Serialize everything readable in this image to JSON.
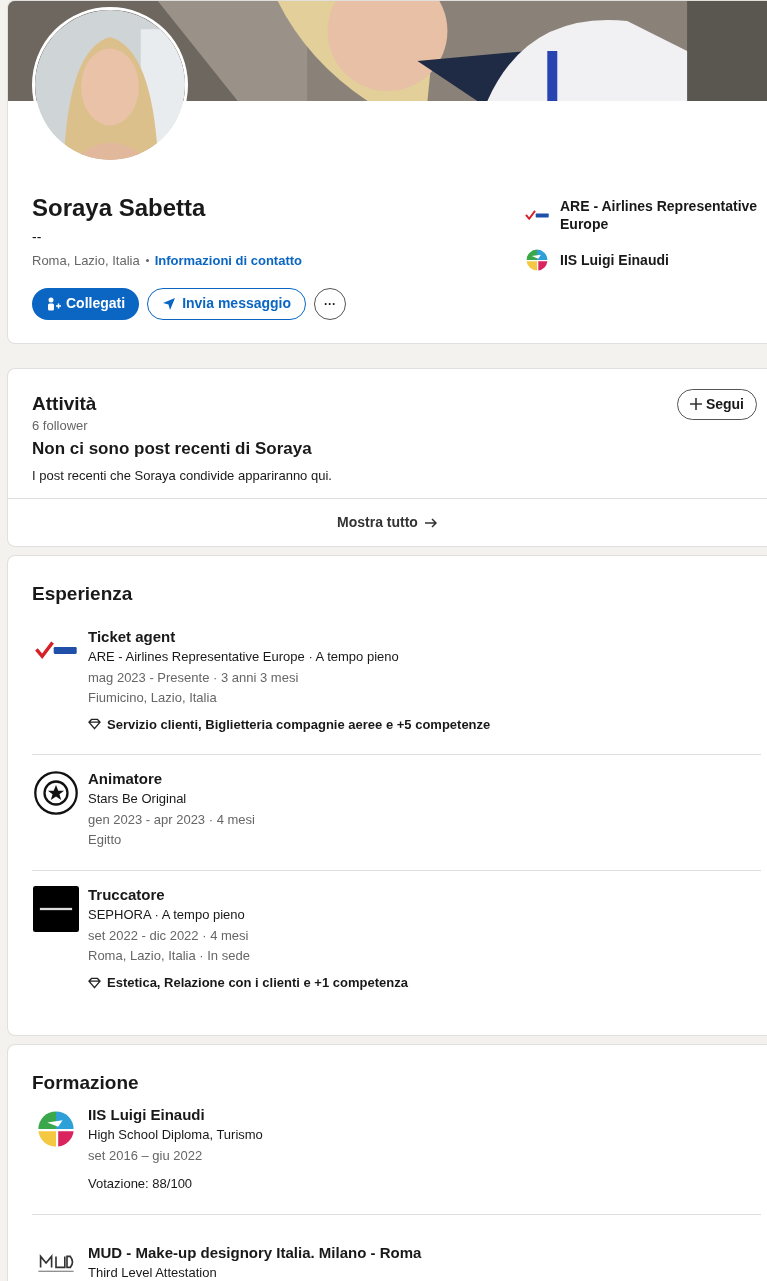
{
  "profile": {
    "name": "Soraya Sabetta",
    "headline": "--",
    "location": "Roma, Lazio, Italia",
    "contact_link": "Informazioni di contatto",
    "connect_button": "Collegati",
    "message_button": "Invia messaggio",
    "more_button": "···",
    "highlights": [
      {
        "kind": "are",
        "label": "ARE - Airlines Representative Europe"
      },
      {
        "kind": "school",
        "label": "IIS Luigi Einaudi"
      }
    ]
  },
  "activity": {
    "title": "Attività",
    "follow_button": "Segui",
    "followers": "6 follower",
    "empty_title": "Non ci sono post recenti di Soraya",
    "empty_text": "I post recenti che Soraya condivide appariranno qui.",
    "show_all": "Mostra tutto"
  },
  "experience": {
    "title": "Esperienza",
    "items": [
      {
        "kind": "are",
        "role": "Ticket agent",
        "company": "ARE - Airlines Representative Europe · A tempo pieno",
        "dates": "mag 2023 - Presente · 3 anni 3 mesi",
        "place": "Fiumicino, Lazio, Italia",
        "skills": "Servizio clienti, Biglietteria compagnie aeree e +5 competenze"
      },
      {
        "kind": "stars",
        "role": "Animatore",
        "company": "Stars Be Original",
        "dates": "gen 2023 - apr 2023 · 4 mesi",
        "place": "Egitto"
      },
      {
        "kind": "sephora",
        "role": "Truccatore",
        "company": "SEPHORA · A tempo pieno",
        "dates": "set 2022 - dic 2022 · 4 mesi",
        "place": "Roma, Lazio, Italia · In sede",
        "skills": "Estetica, Relazione con i clienti e +1 competenza"
      }
    ]
  },
  "education": {
    "title": "Formazione",
    "items": [
      {
        "kind": "school",
        "school": "IIS Luigi Einaudi",
        "degree": "High School Diploma, Turismo",
        "dates": "set 2016 – giu 2022",
        "grade": "Votazione: 88/100"
      },
      {
        "kind": "mud",
        "school": "MUD - Make-up designory Italia. Milano - Roma",
        "degree": "Third Level Attestation"
      }
    ]
  }
}
